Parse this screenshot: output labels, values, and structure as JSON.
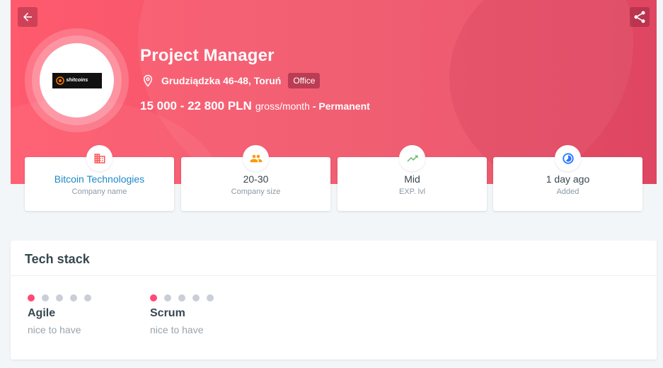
{
  "header": {
    "title": "Project Manager",
    "location": "Grudziądzka 46-48, Toruń",
    "workplace_badge": "Office",
    "salary": "15 000 - 22 800 PLN",
    "salary_period": "gross/month",
    "employment_type": "- Permanent",
    "logo_text": "shitcoins",
    "back_icon": "arrow-left-icon",
    "share_icon": "share-icon"
  },
  "cards": [
    {
      "value": "Bitcoin Technologies",
      "label": "Company name",
      "icon": "building-icon",
      "color": "#ff5252"
    },
    {
      "value": "20-30",
      "label": "Company size",
      "icon": "people-icon",
      "color": "#ff9800"
    },
    {
      "value": "Mid",
      "label": "EXP. lvl",
      "icon": "trending-up-icon",
      "color": "#66bb6a"
    },
    {
      "value": "1 day ago",
      "label": "Added",
      "icon": "clock-icon",
      "color": "#2979ff"
    }
  ],
  "tech_stack": {
    "heading": "Tech stack",
    "skills": [
      {
        "name": "Agile",
        "level_text": "nice to have",
        "level": 1,
        "max": 5
      },
      {
        "name": "Scrum",
        "level_text": "nice to have",
        "level": 1,
        "max": 5
      }
    ]
  },
  "colors": {
    "accent": "#ff4a75",
    "hero": "#f2566b",
    "link": "#1e88c8"
  }
}
